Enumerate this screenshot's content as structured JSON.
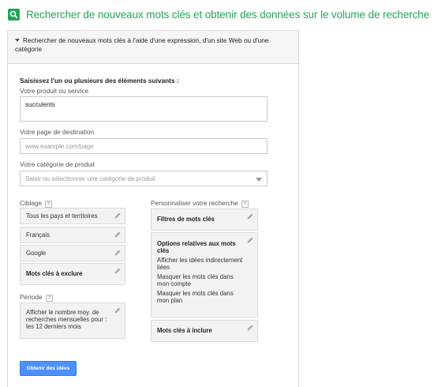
{
  "header": {
    "title": "Rechercher de nouveaux mots clés et obtenir des données sur le volume de recherche",
    "icon": "search-icon"
  },
  "panel": {
    "heading": "Rechercher de nouveaux mots clés à l'aide d'une expression, d'un site Web ou d'une catégorie",
    "intro": "Saisissez l'un ou plusieurs des éléments suivants :",
    "product_label": "Votre produit ou service",
    "product_value": "succulents",
    "landing_label": "Votre page de destination",
    "landing_placeholder": "www.example.com/page",
    "category_label": "Votre catégorie de produit",
    "category_placeholder": "Saisir ou sélectionner une catégorie de produit"
  },
  "targeting": {
    "label": "Ciblage",
    "help": "?",
    "location": "Tous les pays et territoires",
    "language": "Français",
    "network": "Google",
    "negative": "Mots clés à exclure"
  },
  "period": {
    "label": "Période",
    "help": "?",
    "value": "Afficher le nombre moy. de recherches mensuelles pour : les 12 derniers mois"
  },
  "customize": {
    "label": "Personnaliser votre recherche",
    "help": "?",
    "filters": "Filtres de mots clés",
    "options_title": "Options relatives aux mots clés",
    "options_1": "Afficher les idées indirectement liées",
    "options_2": "Masquer les mots clés dans mon compte",
    "options_3": "Masquer les mots clés dans mon plan",
    "include": "Mots clés à inclure"
  },
  "cta_label": "Obtenir des idées",
  "colors": {
    "accent": "#23a55a",
    "button": "#4d90fe"
  }
}
